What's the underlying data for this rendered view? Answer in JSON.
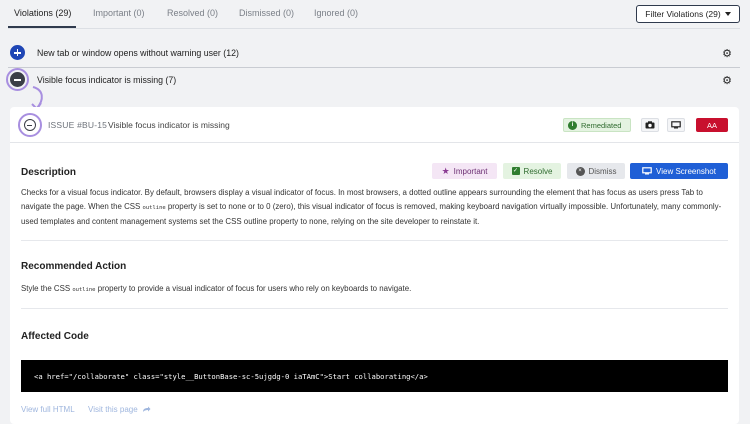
{
  "tabs": [
    {
      "label": "Violations (29)"
    },
    {
      "label": "Important (0)"
    },
    {
      "label": "Resolved (0)"
    },
    {
      "label": "Dismissed (0)"
    },
    {
      "label": "Ignored (0)"
    }
  ],
  "filter": {
    "label": "Filter Violations (29)"
  },
  "groups": [
    {
      "label": "New tab or window opens without warning user (12)"
    },
    {
      "label": "Visible focus indicator is missing (7)"
    }
  ],
  "issue": {
    "id": "ISSUE #BU-15",
    "title": "Visible focus indicator is missing",
    "status": "Remediated",
    "level": "AA"
  },
  "actions": {
    "important": "Important",
    "resolve": "Resolve",
    "dismiss": "Dismiss",
    "view_screenshot": "View Screenshot"
  },
  "description": {
    "title": "Description",
    "text_1": "Checks for a visual focus indicator. By default, browsers display a visual indicator of focus. In most browsers, a dotted outline appears surrounding the element that has focus as users press Tab to navigate the page. When the CSS ",
    "code_1": "outline",
    "text_2": " property is set to none or to 0 (zero), this visual indicator of focus is removed, making keyboard navigation virtually impossible. Unfortunately, many commonly-used templates and content management systems set the CSS outline property to none, relying on the site developer to reinstate it."
  },
  "recommended": {
    "title": "Recommended Action",
    "text_1": "Style the CSS ",
    "code_1": "outline",
    "text_2": " property to provide a visual indicator of focus for users who rely on keyboards to navigate."
  },
  "affected": {
    "title": "Affected Code",
    "code": "<a href=\"/collaborate\" class=\"style__ButtonBase-sc-5ujgdg-0 iaTAmC\">Start collaborating</a>"
  },
  "footer": {
    "view_full_html": "View full HTML",
    "visit_page": "Visit this page"
  },
  "colors": {
    "primary": "#1f46b5",
    "focus_ring": "#a88fe0",
    "level_badge": "#c8102e",
    "remediated": "#2f7d2f"
  }
}
